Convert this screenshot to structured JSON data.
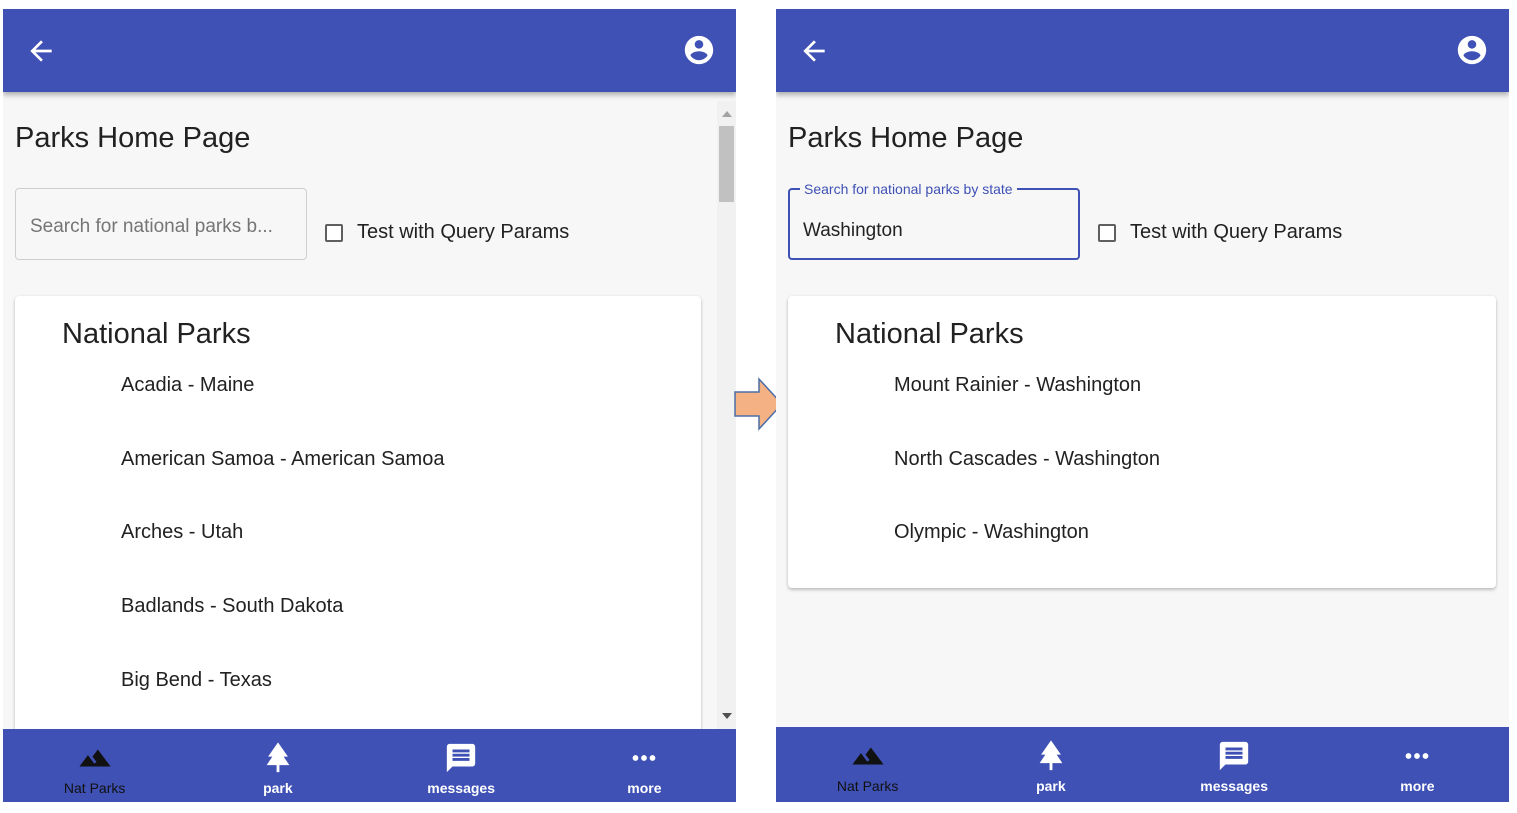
{
  "colors": {
    "app_bar": "#3f51b5",
    "accent": "#3f51b5",
    "arrow_fill": "#f4b183",
    "arrow_stroke": "#4a6fa5"
  },
  "icons": {
    "back": "arrow-back-icon",
    "account": "account-circle-icon",
    "nat_parks": "landscape-icon",
    "park": "tree-icon",
    "messages": "message-icon",
    "more": "more-horiz-icon",
    "connector": "right-arrow-icon"
  },
  "screens": [
    {
      "page_title": "Parks Home Page",
      "search": {
        "placeholder": "Search for national parks b...",
        "value": "",
        "label": ""
      },
      "checkbox": {
        "label": "Test with Query Params",
        "checked": false
      },
      "card": {
        "title": "National Parks",
        "parks": [
          "Acadia - Maine",
          "American Samoa - American Samoa",
          "Arches - Utah",
          "Badlands - South Dakota",
          "Big Bend - Texas"
        ]
      },
      "nav": [
        {
          "label": "Nat Parks",
          "icon": "landscape-icon",
          "active": true
        },
        {
          "label": "park",
          "icon": "tree-icon",
          "active": false
        },
        {
          "label": "messages",
          "icon": "message-icon",
          "active": false
        },
        {
          "label": "more",
          "icon": "more-horiz-icon",
          "active": false
        }
      ]
    },
    {
      "page_title": "Parks Home Page",
      "search": {
        "placeholder": "",
        "value": "Washington",
        "label": "Search for national parks by state"
      },
      "checkbox": {
        "label": "Test with Query Params",
        "checked": false
      },
      "card": {
        "title": "National Parks",
        "parks": [
          "Mount Rainier - Washington",
          "North Cascades - Washington",
          "Olympic - Washington"
        ]
      },
      "nav": [
        {
          "label": "Nat Parks",
          "icon": "landscape-icon",
          "active": true
        },
        {
          "label": "park",
          "icon": "tree-icon",
          "active": false
        },
        {
          "label": "messages",
          "icon": "message-icon",
          "active": false
        },
        {
          "label": "more",
          "icon": "more-horiz-icon",
          "active": false
        }
      ]
    }
  ]
}
